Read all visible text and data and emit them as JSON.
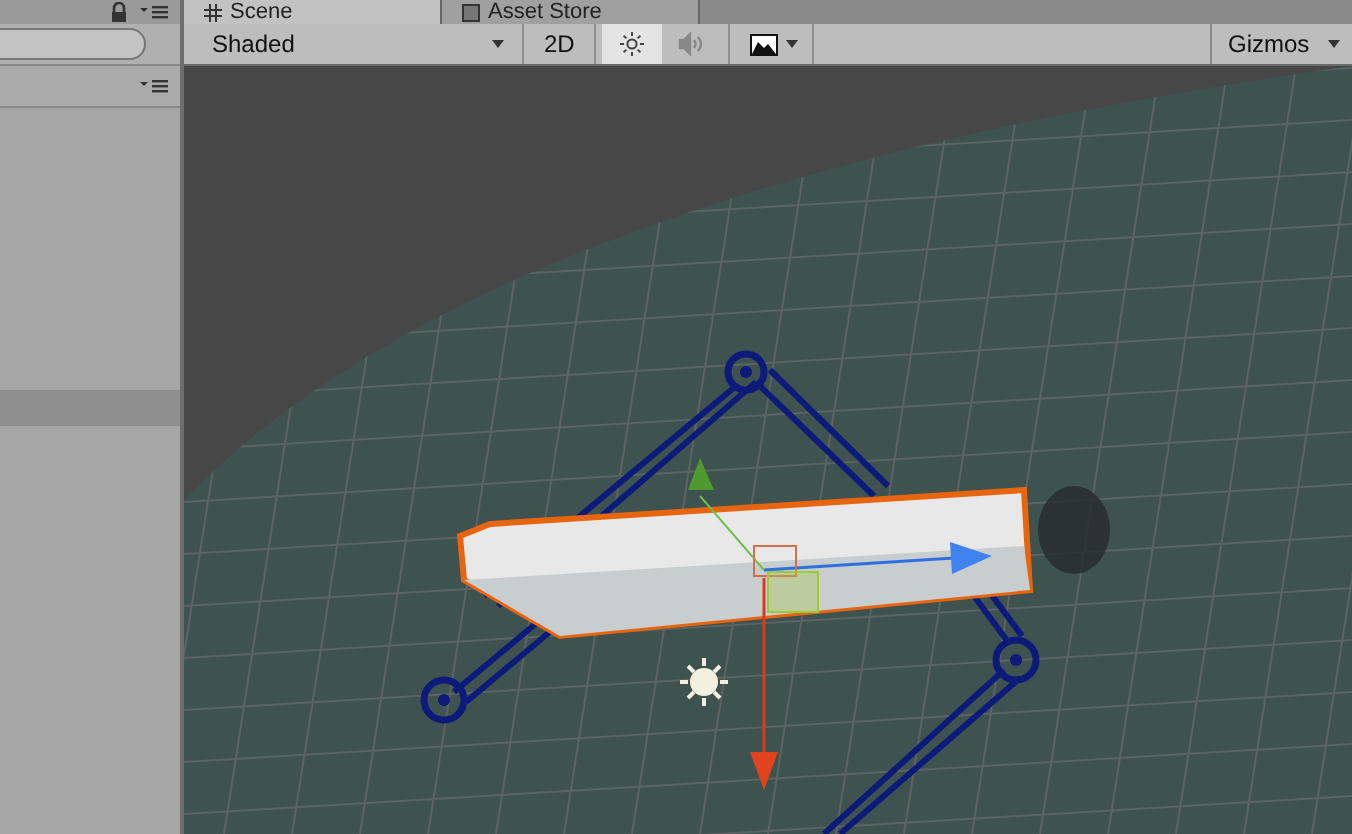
{
  "tabs": [
    {
      "label": "Scene",
      "selected": true
    },
    {
      "label": "Asset Store",
      "selected": false
    }
  ],
  "toolbar": {
    "draw_mode": "Shaded",
    "mode_2d": {
      "label": "2D",
      "on": false
    },
    "lighting_on": true,
    "audio_on": false,
    "gizmos": "Gizmos"
  }
}
